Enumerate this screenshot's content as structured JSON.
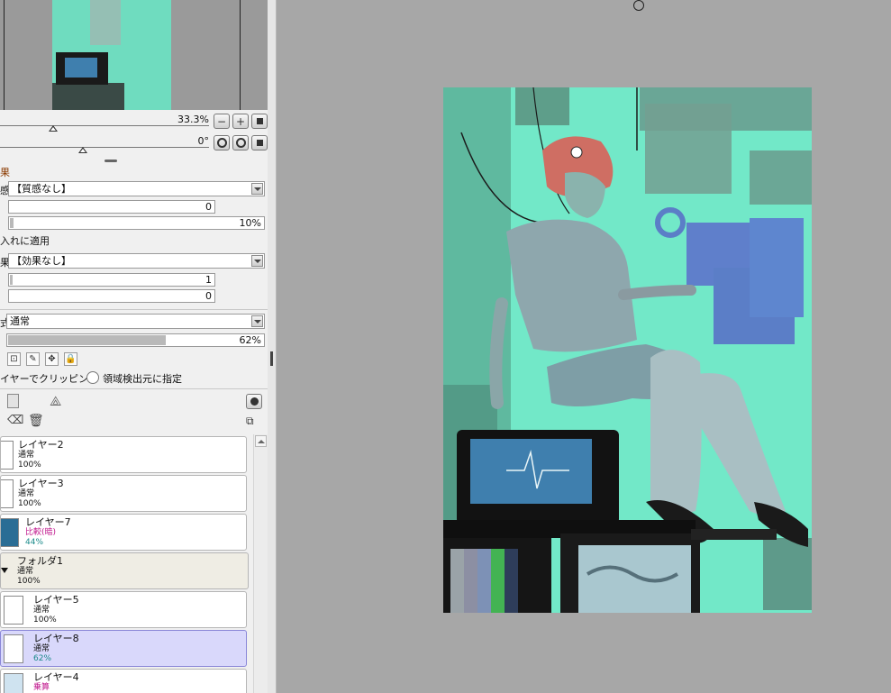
{
  "navigator": {
    "zoom": "33.3%",
    "rotation": "0°"
  },
  "texture": {
    "section_label": "果",
    "label": "感",
    "value": "【質感なし】",
    "amount": "0",
    "strength": "10%",
    "strength_fraction": 0.02
  },
  "apply_checkbox_label": "入れに適用",
  "effect": {
    "label": "果",
    "value": "【効果なし】",
    "width": "1",
    "width_fraction": 0.02,
    "strength": "0"
  },
  "blend": {
    "label": "式",
    "mode": "通常"
  },
  "opacity": {
    "value": "62%",
    "fraction": 0.62
  },
  "clipping_label": "イヤーでクリッピング",
  "region_source_label": "領域検出元に指定",
  "layers": [
    {
      "name": "レイヤー2",
      "mode": "通常",
      "opacity": "100%",
      "special": false
    },
    {
      "name": "レイヤー3",
      "mode": "通常",
      "opacity": "100%",
      "special": false
    },
    {
      "name": "レイヤー7",
      "mode": "比較(暗)",
      "opacity": "44%",
      "special": true
    },
    {
      "name": "フォルダ1",
      "mode": "通常",
      "opacity": "100%",
      "special": false,
      "folder": true
    },
    {
      "name": "レイヤー5",
      "mode": "通常",
      "opacity": "100%",
      "special": false
    },
    {
      "name": "レイヤー8",
      "mode": "通常",
      "opacity": "62%",
      "special": false,
      "selected": true
    },
    {
      "name": "レイヤー4",
      "mode": "乗算",
      "opacity": "",
      "special": true
    }
  ],
  "colors": {
    "canvas_bg": "#72e8c8",
    "workspace": "#a7a7a7",
    "panel": "#f0f0f0",
    "selected_layer": "#d9d8fb",
    "mode_special": "#c0178d",
    "opacity_special": "#1a8a8a"
  }
}
